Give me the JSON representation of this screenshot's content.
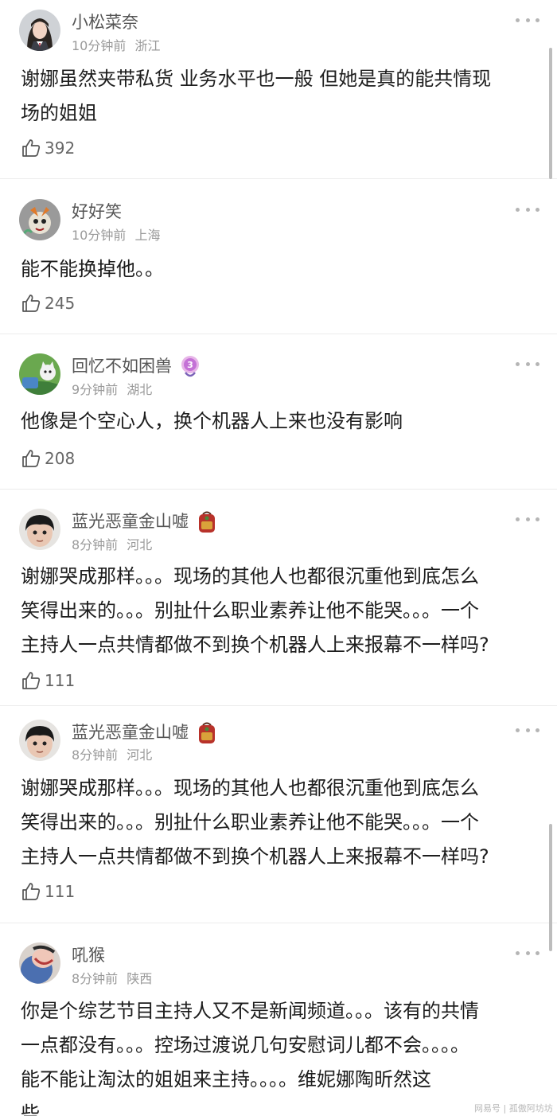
{
  "comments": [
    {
      "username": "小松菜奈",
      "time": "10分钟前",
      "location": "浙江",
      "lines": [
        "谢娜虽然夹带私货 业务水平也一般 但她是真的能共情现",
        "场的姐姐"
      ],
      "likes": "392",
      "avatar_icon": "user-avatar-girl-icon"
    },
    {
      "username": "好好笑",
      "time": "10分钟前",
      "location": "上海",
      "lines": [
        "能不能换掉他。。"
      ],
      "likes": "245",
      "avatar_icon": "user-avatar-cartoon-icon"
    },
    {
      "username": "回忆不如困兽",
      "time": "9分钟前",
      "location": "湖北",
      "lines": [
        "他像是个空心人，换个机器人上来也没有影响"
      ],
      "likes": "208",
      "avatar_icon": "user-avatar-cartoon-cat-icon",
      "badge_icon": "level-3-badge-icon"
    },
    {
      "username": "蓝光恶童金山嘘",
      "time": "8分钟前",
      "location": "河北",
      "lines": [
        "谢娜哭成那样。。。现场的其他人也都很沉重他到底怎么",
        "笑得出来的。。。别扯什么职业素养让他不能哭。。。一个",
        "主持人一点共情都做不到换个机器人上来报幕不一样吗?"
      ],
      "likes": "111",
      "avatar_icon": "user-avatar-child-icon",
      "badge_icon": "backpack-badge-icon"
    },
    {
      "username": "蓝光恶童金山嘘",
      "time": "8分钟前",
      "location": "河北",
      "lines": [
        "谢娜哭成那样。。。现场的其他人也都很沉重他到底怎么",
        "笑得出来的。。。别扯什么职业素养让他不能哭。。。一个",
        "主持人一点共情都做不到换个机器人上来报幕不一样吗?"
      ],
      "likes": "111",
      "avatar_icon": "user-avatar-child-icon",
      "badge_icon": "backpack-badge-icon"
    },
    {
      "username": "吼猴",
      "time": "8分钟前",
      "location": "陕西",
      "lines": [
        "你是个综艺节目主持人又不是新闻频道。。。该有的共情",
        "一点都没有。。。控场过渡说几句安慰词儿都不会。。。。",
        "能不能让淘汰的姐姐来主持。。。。维妮娜陶昕然这",
        "些"
      ],
      "likes": "",
      "avatar_icon": "user-avatar-photo-icon"
    }
  ],
  "watermark": "网易号 | 孤傲阿坊坊",
  "colors": {
    "username": "#555555",
    "meta": "#9a9a9a",
    "text": "#1d1d1d",
    "divider": "#ececec"
  }
}
